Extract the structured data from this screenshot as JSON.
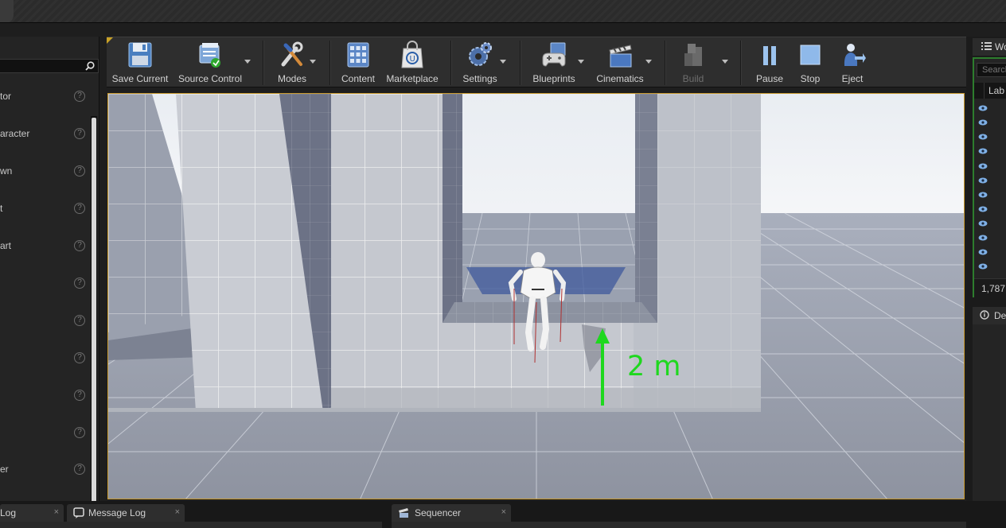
{
  "placement_panel": {
    "items": [
      {
        "label": "tor",
        "help": "?"
      },
      {
        "label": "aracter",
        "help": "?"
      },
      {
        "label": "wn",
        "help": "?"
      },
      {
        "label": "t",
        "help": "?"
      },
      {
        "label": "art",
        "help": "?"
      },
      {
        "label": "",
        "help": "?"
      },
      {
        "label": "",
        "help": "?"
      },
      {
        "label": "",
        "help": "?"
      },
      {
        "label": "",
        "help": "?"
      },
      {
        "label": "",
        "help": "?"
      },
      {
        "label": "er",
        "help": "?"
      }
    ]
  },
  "toolbar": {
    "save_current": "Save Current",
    "source_control": "Source Control",
    "modes": "Modes",
    "content": "Content",
    "marketplace": "Marketplace",
    "settings": "Settings",
    "blueprints": "Blueprints",
    "cinematics": "Cinematics",
    "build": "Build",
    "pause": "Pause",
    "stop": "Stop",
    "eject": "Eject"
  },
  "viewport": {
    "measure_label": "2 m"
  },
  "world_outliner": {
    "tab_title": "Wo",
    "search_placeholder": "Search",
    "column_label": "Lab",
    "actor_count": "1,787"
  },
  "details": {
    "tab_title": "Det"
  },
  "bottom_tabs": {
    "output_log": "Log",
    "message_log": "Message Log",
    "sequencer": "Sequencer",
    "close_glyph": "×"
  },
  "colors": {
    "accent_gold": "#c99a2e",
    "measure_green": "#1ed81e",
    "outliner_border": "#2d7d2d"
  }
}
